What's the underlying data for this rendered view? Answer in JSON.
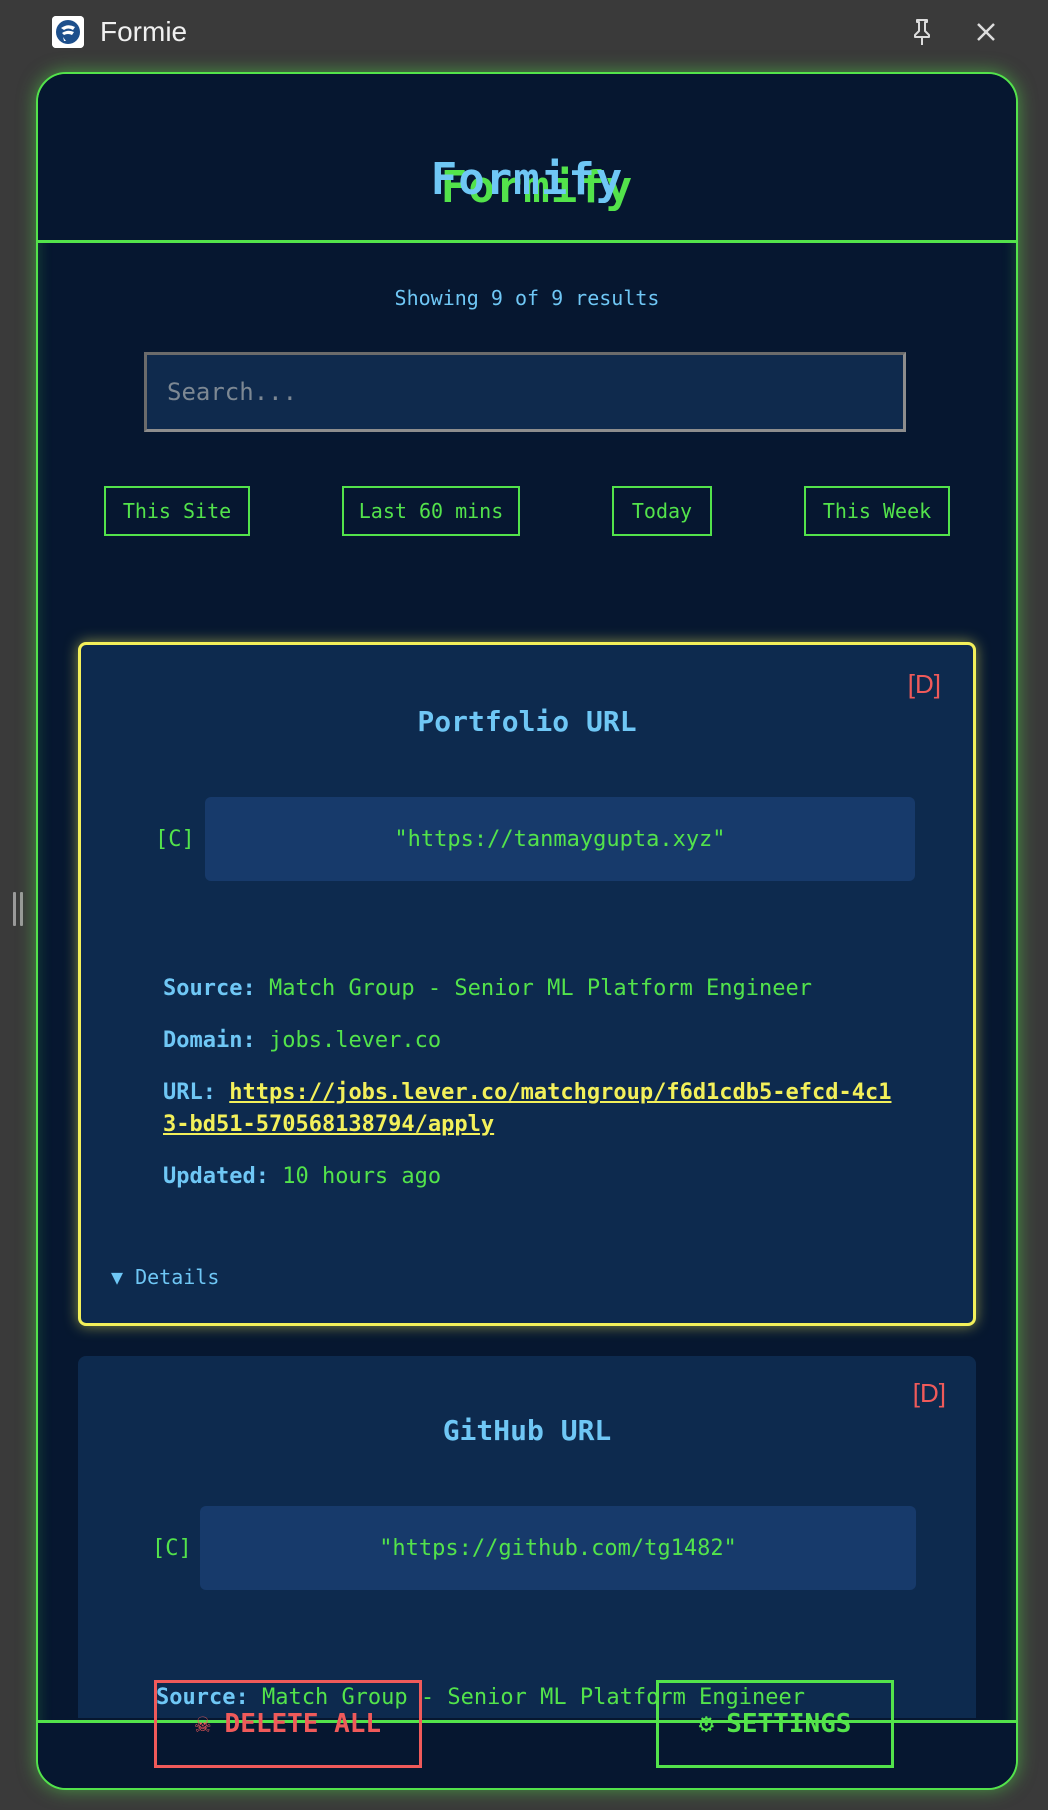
{
  "window": {
    "title": "Formie"
  },
  "header": {
    "logo_text": "Formify"
  },
  "results": {
    "text": "Showing 9 of 9 results"
  },
  "search": {
    "placeholder": "Search..."
  },
  "filters": [
    {
      "label": "This Site"
    },
    {
      "label": "Last 60 mins"
    },
    {
      "label": "Today"
    },
    {
      "label": "This Week"
    }
  ],
  "cards": [
    {
      "delete_label": "[D]",
      "title": "Portfolio URL",
      "copy_label": "[C]",
      "value": "\"https://tanmaygupta.xyz\"",
      "source_label": "Source:",
      "source": "Match Group - Senior ML Platform Engineer",
      "domain_label": "Domain:",
      "domain": "jobs.lever.co",
      "url_label": "URL:",
      "url": "https://jobs.lever.co/matchgroup/f6d1cdb5-efcd-4c13-bd51-570568138794/apply",
      "updated_label": "Updated:",
      "updated": "10 hours ago",
      "details_label": "▼ Details"
    },
    {
      "delete_label": "[D]",
      "title": "GitHub URL",
      "copy_label": "[C]",
      "value": "\"https://github.com/tg1482\"",
      "source_label": "Source:",
      "source": "Match Group - Senior ML Platform Engineer"
    }
  ],
  "footer": {
    "delete_all_icon": "☠",
    "delete_all_label": "DELETE ALL",
    "settings_icon": "⚙",
    "settings_label": "SETTINGS"
  },
  "icons": {
    "app": "formie-logo-icon",
    "pin": "pin-icon",
    "close": "close-icon",
    "drag": "drag-handle-icon",
    "skull": "skull-icon",
    "gear": "gear-icon"
  },
  "colors": {
    "accent_green": "#53e34b",
    "accent_blue": "#6fc7f5",
    "highlight_yellow": "#f3f05a",
    "danger_red": "#ef5a5a",
    "panel_bg": "#061730",
    "card_bg": "#0d2a4e"
  }
}
